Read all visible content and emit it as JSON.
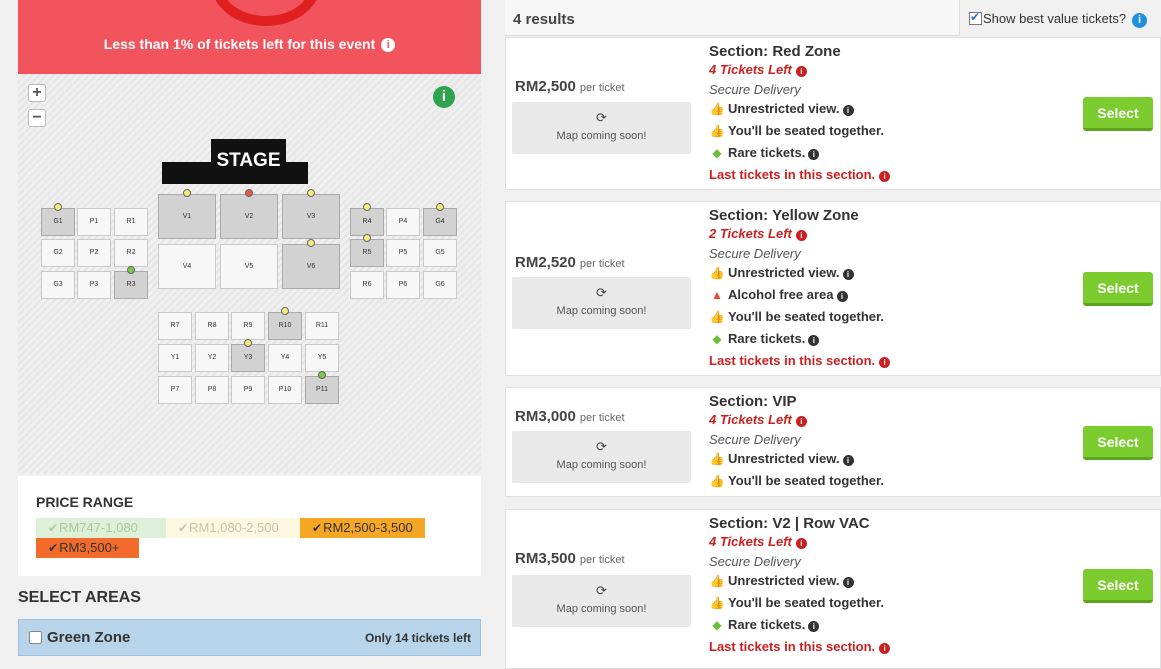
{
  "alert": {
    "message": "Less than 1% of tickets left for this event"
  },
  "map": {
    "zoom_in": "+",
    "zoom_out": "−",
    "info": "i",
    "stage": "STAGE",
    "sections": {
      "G1": "G1",
      "P1": "P1",
      "R1": "R1",
      "G2": "G2",
      "P2": "P2",
      "R2": "R2",
      "G3": "G3",
      "P3": "P3",
      "R3": "R3",
      "V1": "V1",
      "V2": "V2",
      "V3": "V3",
      "V4": "V4",
      "V5": "V5",
      "V6": "V6",
      "R4": "R4",
      "P4": "P4",
      "G4": "G4",
      "R5": "R5",
      "P5": "P5",
      "G5": "G5",
      "R6": "R6",
      "P6": "P6",
      "G6": "G6",
      "R7": "R7",
      "R8": "R8",
      "R9": "R9",
      "R10": "R10",
      "R11": "R11",
      "Y1": "Y1",
      "Y2": "Y2",
      "Y3": "Y3",
      "Y4": "Y4",
      "Y5": "Y5",
      "P7": "P7",
      "P8": "P8",
      "P9": "P9",
      "P10": "P10",
      "P11": "P11"
    }
  },
  "price_range": {
    "title": "PRICE RANGE",
    "tags": [
      {
        "label": "RM747-1,080",
        "bg": "#dff0d8",
        "color": "#a9c8a0"
      },
      {
        "label": "RM1,080-2,500",
        "bg": "#fdf8df",
        "color": "#c8c4a8"
      },
      {
        "label": "RM2,500-3,500",
        "bg": "#f5a623",
        "color": "#333333"
      },
      {
        "label": "RM3,500+",
        "bg": "#f26b2a",
        "color": "#333333"
      }
    ]
  },
  "select_areas": {
    "title": "SELECT AREAS",
    "zone_name": "Green Zone",
    "zone_tickets": "Only 14 tickets left"
  },
  "results": {
    "count": "4 results",
    "best_value": "Show best value tickets?"
  },
  "listings": [
    {
      "price": "RM2,500",
      "per": "per ticket",
      "map_text": "Map coming soon!",
      "title": "Section: Red Zone",
      "tickets_left": "4 Tickets Left",
      "delivery": "Secure Delivery",
      "f1": "Unrestricted view.",
      "f2": "You'll be seated together.",
      "f3": "Rare tickets.",
      "last": "Last tickets in this section.",
      "button": "Select"
    },
    {
      "price": "RM2,520",
      "per": "per ticket",
      "map_text": "Map coming soon!",
      "title": "Section: Yellow Zone",
      "tickets_left": "2 Tickets Left",
      "delivery": "Secure Delivery",
      "f1": "Unrestricted view.",
      "f_alcohol": "Alcohol free area",
      "f2": "You'll be seated together.",
      "f3": "Rare tickets.",
      "last": "Last tickets in this section.",
      "button": "Select"
    },
    {
      "price": "RM3,000",
      "per": "per ticket",
      "map_text": "Map coming soon!",
      "title": "Section: VIP",
      "tickets_left": "4 Tickets Left",
      "delivery": "Secure Delivery",
      "f1": "Unrestricted view.",
      "f2": "You'll be seated together.",
      "button": "Select"
    },
    {
      "price": "RM3,500",
      "per": "per ticket",
      "map_text": "Map coming soon!",
      "title": "Section: V2 | Row VAC",
      "tickets_left": "4 Tickets Left",
      "delivery": "Secure Delivery",
      "f1": "Unrestricted view.",
      "f2": "You'll be seated together.",
      "f3": "Rare tickets.",
      "last": "Last tickets in this section.",
      "button": "Select"
    }
  ]
}
